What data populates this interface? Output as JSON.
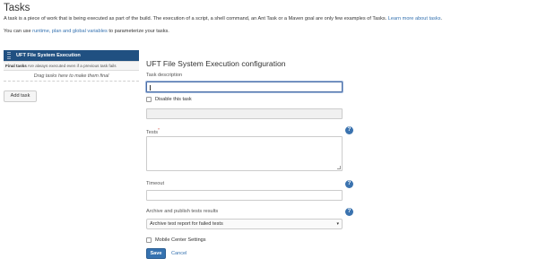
{
  "header": {
    "title": "Tasks",
    "description": "A task is a piece of work that is being executed as part of the build. The execution of a script, a shell command, an Ant Task or a Maven goal are only few examples of Tasks.",
    "learn_more": "Learn more about tasks",
    "variables_prefix": "You can use",
    "runtime_link": "runtime, plan and global variables",
    "variables_suffix": "to parameterize your tasks."
  },
  "task_list": {
    "items": [
      {
        "label": "UFT File System Execution"
      }
    ],
    "final_tasks_label": "Final tasks",
    "final_tasks_hint": "Are always executed even if a previous task fails",
    "drag_hint": "Drag tasks here to make them final",
    "add_task_label": "Add task"
  },
  "form": {
    "title": "UFT File System Execution configuration",
    "task_description_label": "Task description",
    "task_description_value": "",
    "disable_label": "Disable this task",
    "tests_label": "Tests",
    "tests_required_mark": "*",
    "tests_value": "",
    "timeout_label": "Timeout",
    "timeout_value": "",
    "archive_label": "Archive and publish tests results",
    "archive_selected": "Archive test report for failed tests",
    "mobile_label": "Mobile Center Settings",
    "save_label": "Save",
    "cancel_label": "Cancel",
    "help_glyph": "?"
  },
  "colors": {
    "accent": "#3572b0",
    "task_selected_bg": "#205081",
    "help_icon": "#3b73af"
  }
}
